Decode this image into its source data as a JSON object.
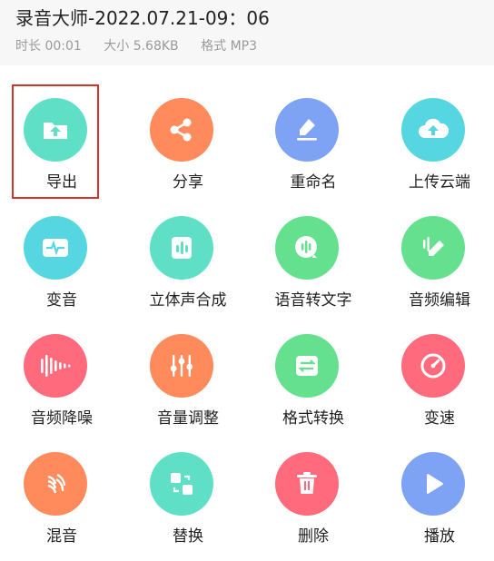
{
  "recording": {
    "title": "录音大师-2022.07.21-09：06",
    "duration": "时长 00:01",
    "size": "大小 5.68KB",
    "format": "格式 MP3"
  },
  "actions": [
    {
      "label": "导出",
      "icon": "export-folder-icon",
      "color": "#5fe0c6"
    },
    {
      "label": "分享",
      "icon": "share-icon",
      "color": "#ff8a5c"
    },
    {
      "label": "重命名",
      "icon": "rename-pen-icon",
      "color": "#7ea2f4"
    },
    {
      "label": "上传云端",
      "icon": "cloud-upload-icon",
      "color": "#55d6e0"
    },
    {
      "label": "变音",
      "icon": "waveform-voice-icon",
      "color": "#55d6e0"
    },
    {
      "label": "立体声合成",
      "icon": "stereo-bars-icon",
      "color": "#5fe0c6"
    },
    {
      "label": "语音转文字",
      "icon": "speech-to-text-icon",
      "color": "#64e08e"
    },
    {
      "label": "音频编辑",
      "icon": "audio-edit-icon",
      "color": "#64e08e"
    },
    {
      "label": "音频降噪",
      "icon": "noise-reduction-icon",
      "color": "#ff6b7d"
    },
    {
      "label": "音量调整",
      "icon": "volume-sliders-icon",
      "color": "#ff8a5c"
    },
    {
      "label": "格式转换",
      "icon": "format-convert-icon",
      "color": "#64e08e"
    },
    {
      "label": "变速",
      "icon": "speed-gauge-icon",
      "color": "#ff6b7d"
    },
    {
      "label": "混音",
      "icon": "mix-sound-icon",
      "color": "#ff8a5c"
    },
    {
      "label": "替换",
      "icon": "replace-icon",
      "color": "#5fe0c6"
    },
    {
      "label": "删除",
      "icon": "trash-icon",
      "color": "#ff6b7d"
    },
    {
      "label": "播放",
      "icon": "play-icon",
      "color": "#7ea2f4"
    }
  ],
  "selected_action": "导出"
}
